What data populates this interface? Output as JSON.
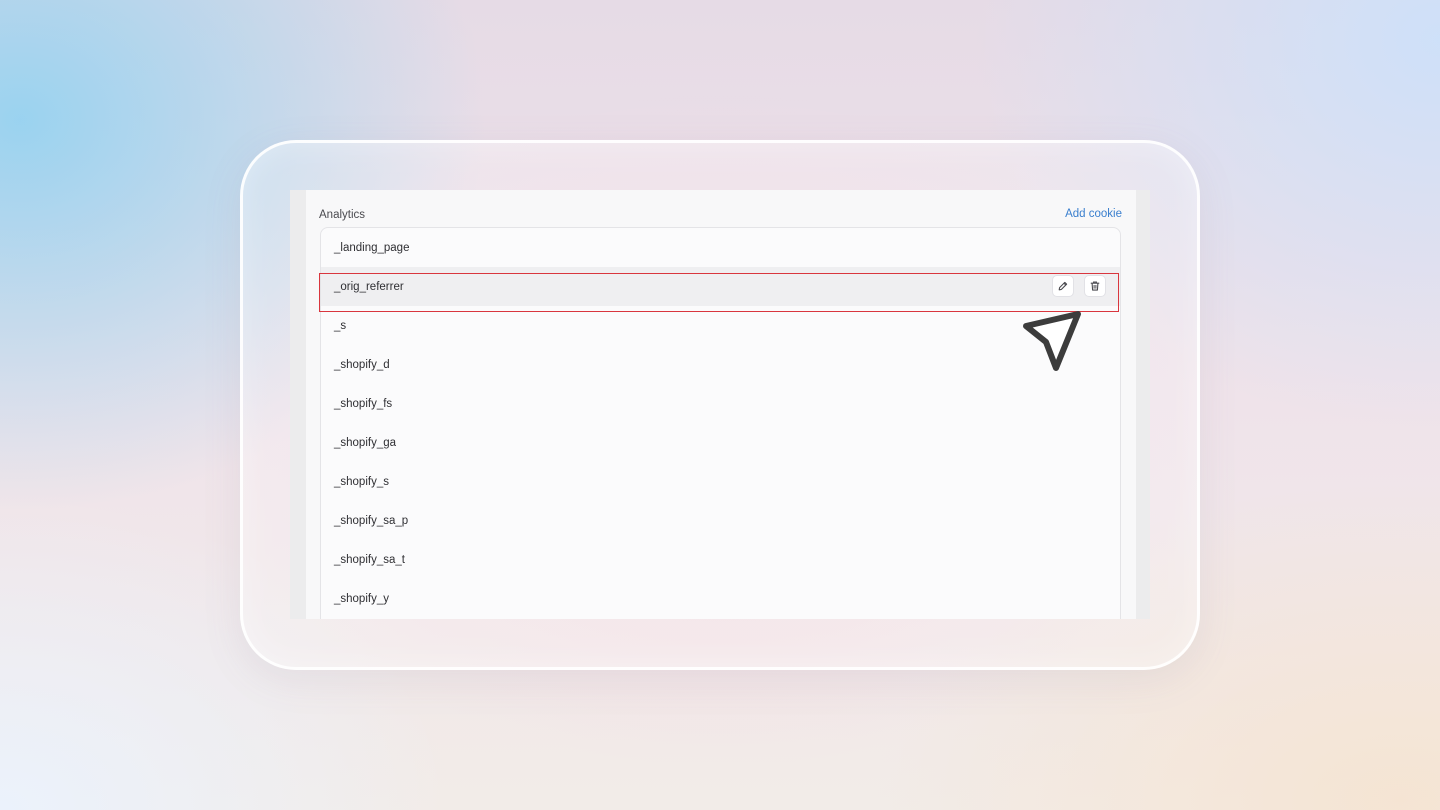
{
  "section": {
    "title": "Analytics",
    "add_label": "Add cookie"
  },
  "cookies": [
    "_landing_page",
    "_orig_referrer",
    "_s",
    "_shopify_d",
    "_shopify_fs",
    "_shopify_ga",
    "_shopify_s",
    "_shopify_sa_p",
    "_shopify_sa_t",
    "_shopify_y"
  ],
  "hovered_row": 1,
  "row_actions": {
    "edit_icon": "pencil-icon",
    "delete_icon": "trash-icon"
  },
  "colors": {
    "accent": "#3a7fce",
    "highlight": "#d9363e",
    "cursor": "#3c3c3c"
  }
}
